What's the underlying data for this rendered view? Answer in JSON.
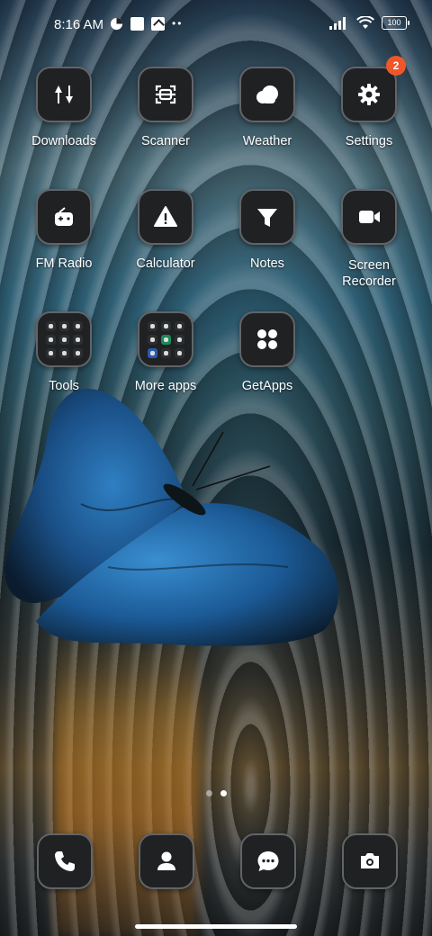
{
  "status_bar": {
    "time": "8:16 AM",
    "battery": "100",
    "icons": [
      "cellular-signal-icon",
      "wifi-icon"
    ]
  },
  "apps": [
    {
      "label": "Downloads",
      "icon": "downloads-icon"
    },
    {
      "label": "Scanner",
      "icon": "scanner-icon"
    },
    {
      "label": "Weather",
      "icon": "weather-icon"
    },
    {
      "label": "Settings",
      "icon": "gear-icon",
      "badge": "2"
    },
    {
      "label": "FM Radio",
      "icon": "radio-icon"
    },
    {
      "label": "Calculator",
      "icon": "calculator-icon"
    },
    {
      "label": "Notes",
      "icon": "notes-icon"
    },
    {
      "label": "Screen Recorder",
      "label_line1": "Screen",
      "label_line2": "Recorder",
      "icon": "video-camera-icon"
    },
    {
      "label": "Tools",
      "icon": "folder-icon"
    },
    {
      "label": "More apps",
      "icon": "folder-icon"
    },
    {
      "label": "GetApps",
      "icon": "grid-icon"
    }
  ],
  "dock": [
    {
      "name": "phone",
      "icon": "phone-icon"
    },
    {
      "name": "contacts",
      "icon": "contacts-icon"
    },
    {
      "name": "messages",
      "icon": "messages-icon"
    },
    {
      "name": "camera",
      "icon": "camera-icon"
    }
  ],
  "pager": {
    "pages": 2,
    "active": 2
  },
  "colors": {
    "badge": "#f0562a",
    "tile_bg": "#1f2123",
    "tile_border": "#616468"
  }
}
